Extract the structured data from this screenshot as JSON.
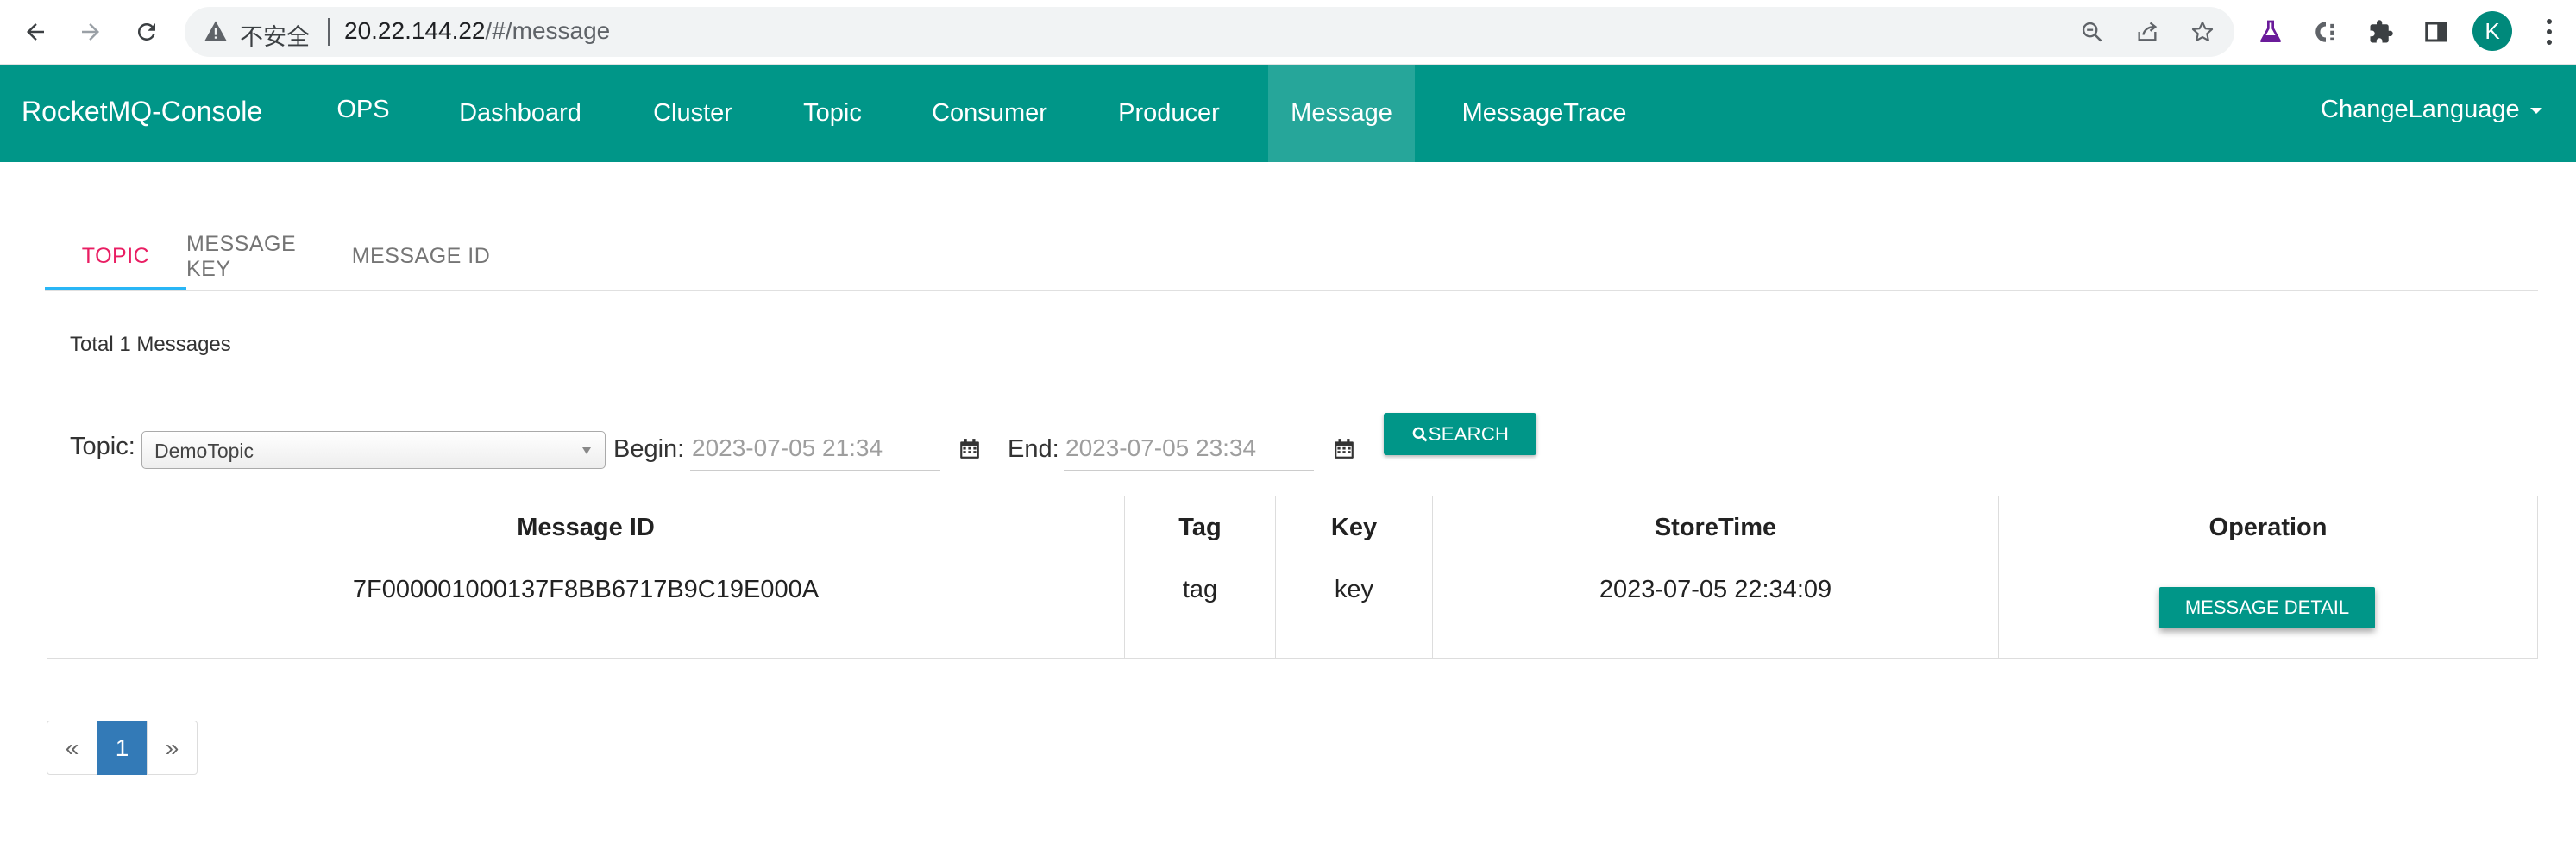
{
  "browser": {
    "insecure_label": "不安全",
    "url_host": "20.22.144.22",
    "url_path": "/#/message",
    "profile_initial": "K"
  },
  "navbar": {
    "brand": "RocketMQ-Console",
    "items": [
      "OPS",
      "Dashboard",
      "Cluster",
      "Topic",
      "Consumer",
      "Producer",
      "Message",
      "MessageTrace"
    ],
    "active": "Message",
    "language": "ChangeLanguage"
  },
  "tabs": {
    "items": [
      "TOPIC",
      "MESSAGE KEY",
      "MESSAGE ID"
    ],
    "active": "TOPIC"
  },
  "summary": {
    "total_text": "Total 1 Messages"
  },
  "filter": {
    "topic_label": "Topic:",
    "topic_value": "DemoTopic",
    "begin_label": "Begin:",
    "begin_value": "2023-07-05 21:34",
    "end_label": "End:",
    "end_value": "2023-07-05 23:34",
    "search_label": "SEARCH"
  },
  "table": {
    "headers": [
      "Message ID",
      "Tag",
      "Key",
      "StoreTime",
      "Operation"
    ],
    "rows": [
      {
        "message_id": "7F000001000137F8BB6717B9C19E000A",
        "tag": "tag",
        "key": "key",
        "store_time": "2023-07-05 22:34:09",
        "operation_label": "MESSAGE DETAIL"
      }
    ]
  },
  "pagination": {
    "prev": "«",
    "pages": [
      "1"
    ],
    "current": "1",
    "next": "»"
  },
  "colors": {
    "primary": "#009688",
    "nav_active": "#26a69a",
    "tab_active": "#e91e63",
    "tab_ink": "#29b6f6",
    "page_active": "#337ab7"
  }
}
